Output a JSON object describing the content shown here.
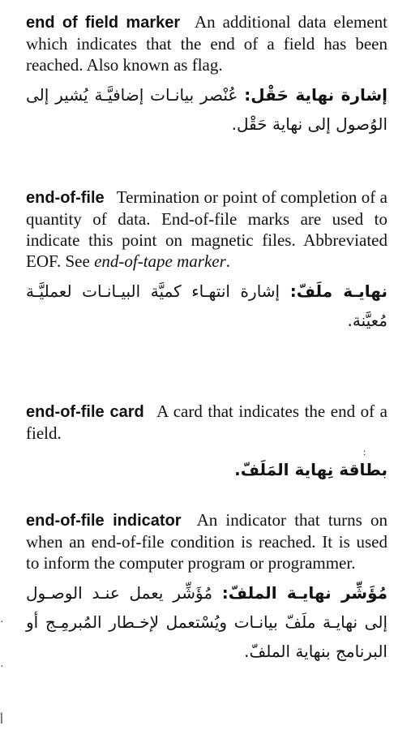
{
  "entries": [
    {
      "term": "end of field marker",
      "definition": "An additional data element which indicates that the end of a field has been reached. Also known as flag.",
      "arabic_term": "إشارة نهاية حَقْل:",
      "arabic_definition": "عُنْصر بيانـات إضافيَّـة يُشير إلى الوُصول إلى نهاية حَقْل."
    },
    {
      "term": "end-of-file",
      "definition": "Termination or point of completion of a quantity of data. End-of-file marks are used to indicate this point on magnetic files. Abbreviated EOF. See",
      "see_also": "end-of-tape marker",
      "definition_end": ".",
      "arabic_term": "نهايـة ملَفّ:",
      "arabic_definition": "إشارة انتهـاء كميَّة البيـانـات لعمليَّـة مُعيَّنة."
    },
    {
      "term": "end-of-file card",
      "definition": "A card that indicates the end of a field.",
      "arabic_term": "بطاقة نِهاية المَلَفّ.",
      "arabic_definition": ""
    },
    {
      "term": "end-of-file indicator",
      "definition": "An indicator that turns on  when an end-of-file condition is reached. It is used to inform the computer program or programmer.",
      "arabic_term": "مُؤَشِّر نهايـة الملفّ:",
      "arabic_definition": "مُؤَشِّر يعمل عنـد الوصـول إلى نهايـة ملَفّ بيانـات ويُسْتعمل لإخـطار المُبرمِـج أو البرنامج بنهاية الملفّ."
    }
  ],
  "stray_marks": {
    "colon": ":",
    "edge_top": "·",
    "edge_mid": "·",
    "edge_bottom": "أ"
  }
}
